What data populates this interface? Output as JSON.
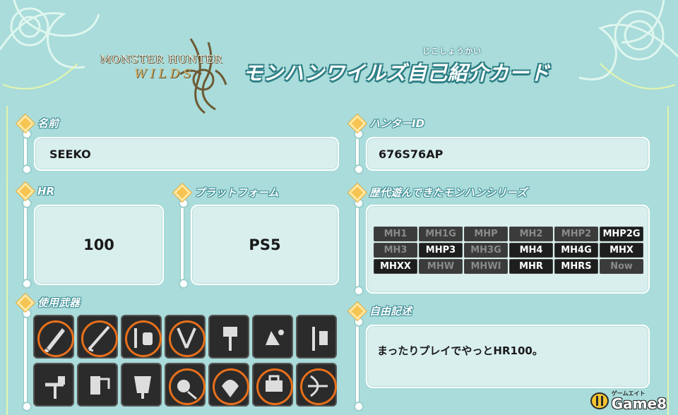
{
  "logo": {
    "line1": "MONSTER HUNTER",
    "line2": "WILDS"
  },
  "title": {
    "ruby": "じこしょうかい",
    "main": "モンハンワイルズ自己紹介カード"
  },
  "fields": {
    "name": {
      "label": "名前",
      "value": "SEEKO"
    },
    "hunter_id": {
      "label": "ハンターID",
      "value": "676S76AP"
    },
    "hr": {
      "label": "HR",
      "value": "100"
    },
    "platform": {
      "label": "プラットフォーム",
      "value": "PS5"
    },
    "series_label": "歴代遊んできたモンハンシリーズ",
    "weapons_label": "使用武器",
    "free": {
      "label": "自由記述",
      "value": "まったりプレイでやっとHR100。"
    }
  },
  "series": [
    {
      "name": "MH1",
      "played": false
    },
    {
      "name": "MH1G",
      "played": false
    },
    {
      "name": "MHP",
      "played": false
    },
    {
      "name": "MH2",
      "played": false
    },
    {
      "name": "MHP2",
      "played": false
    },
    {
      "name": "MHP2G",
      "played": true
    },
    {
      "name": "MH3",
      "played": false
    },
    {
      "name": "MHP3",
      "played": true
    },
    {
      "name": "MH3G",
      "played": false
    },
    {
      "name": "MH4",
      "played": true
    },
    {
      "name": "MH4G",
      "played": true
    },
    {
      "name": "MHX",
      "played": true
    },
    {
      "name": "MHXX",
      "played": true
    },
    {
      "name": "MHW",
      "played": false
    },
    {
      "name": "MHWI",
      "played": false
    },
    {
      "name": "MHR",
      "played": true
    },
    {
      "name": "MHRS",
      "played": true
    },
    {
      "name": "Now",
      "played": false
    }
  ],
  "weapons": [
    {
      "icon": "great-sword-icon",
      "selected": true
    },
    {
      "icon": "long-sword-icon",
      "selected": true
    },
    {
      "icon": "sword-and-shield-icon",
      "selected": true
    },
    {
      "icon": "dual-blades-icon",
      "selected": true
    },
    {
      "icon": "hammer-icon",
      "selected": false
    },
    {
      "icon": "hunting-horn-icon",
      "selected": false
    },
    {
      "icon": "lance-icon",
      "selected": false
    },
    {
      "icon": "gunlance-icon",
      "selected": false
    },
    {
      "icon": "switch-axe-icon",
      "selected": false
    },
    {
      "icon": "charge-blade-icon",
      "selected": false
    },
    {
      "icon": "insect-glaive-icon",
      "selected": true
    },
    {
      "icon": "light-bowgun-icon",
      "selected": true
    },
    {
      "icon": "heavy-bowgun-icon",
      "selected": true
    },
    {
      "icon": "bow-icon",
      "selected": true
    }
  ],
  "footer": {
    "kana": "ゲームエイト",
    "brand": "Game8"
  },
  "colors": {
    "background": "#a9dcda",
    "accent": "#e8701a",
    "diamond": "#f6c453"
  }
}
